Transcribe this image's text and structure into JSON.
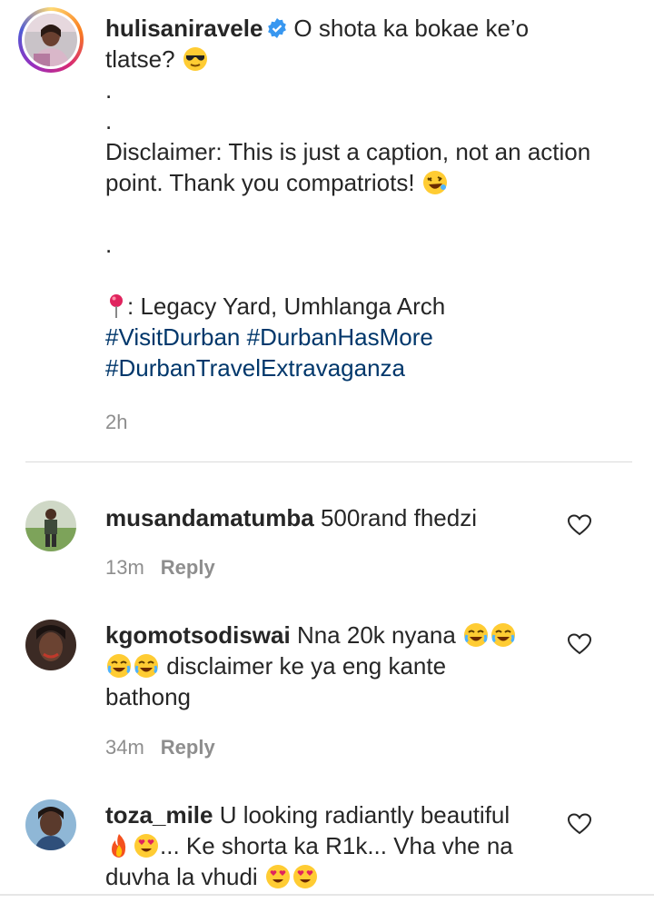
{
  "caption": {
    "username": "hulisaniravele",
    "text_line1": "O shota ka bokae ke’o",
    "text_line2": "tlatse?",
    "dot1": ".",
    "dot2": ".",
    "disclaimer": "Disclaimer: This is just a caption, not an action point. Thank you compatriots!",
    "dot3": ".",
    "location": ": Legacy Yard, Umhlanga Arch",
    "hashtags": [
      "#VisitDurban",
      "#DurbanHasMore",
      "#DurbanTravelExtravaganza"
    ],
    "time": "2h"
  },
  "comments": [
    {
      "username": "musandamatumba",
      "text": "500rand fhedzi",
      "time": "13m",
      "reply_label": "Reply"
    },
    {
      "username": "kgomotsodiswai",
      "text_a": "Nna 20k nyana",
      "text_b": "disclaimer ke ya eng kante bathong",
      "time": "34m",
      "reply_label": "Reply"
    },
    {
      "username": "toza_mile",
      "text_a": "U looking radiantly beautiful",
      "text_b": "... Ke shorta ka R1k... Vha vhe na duvha la vhudi"
    }
  ],
  "icons": {
    "verified": "verified-badge-icon",
    "heart": "heart-outline-icon",
    "pin": "round-pushpin-icon"
  },
  "colors": {
    "text": "#262626",
    "secondary": "#8e8e8e",
    "hashtag": "#00376b",
    "verified": "#3897f0"
  }
}
